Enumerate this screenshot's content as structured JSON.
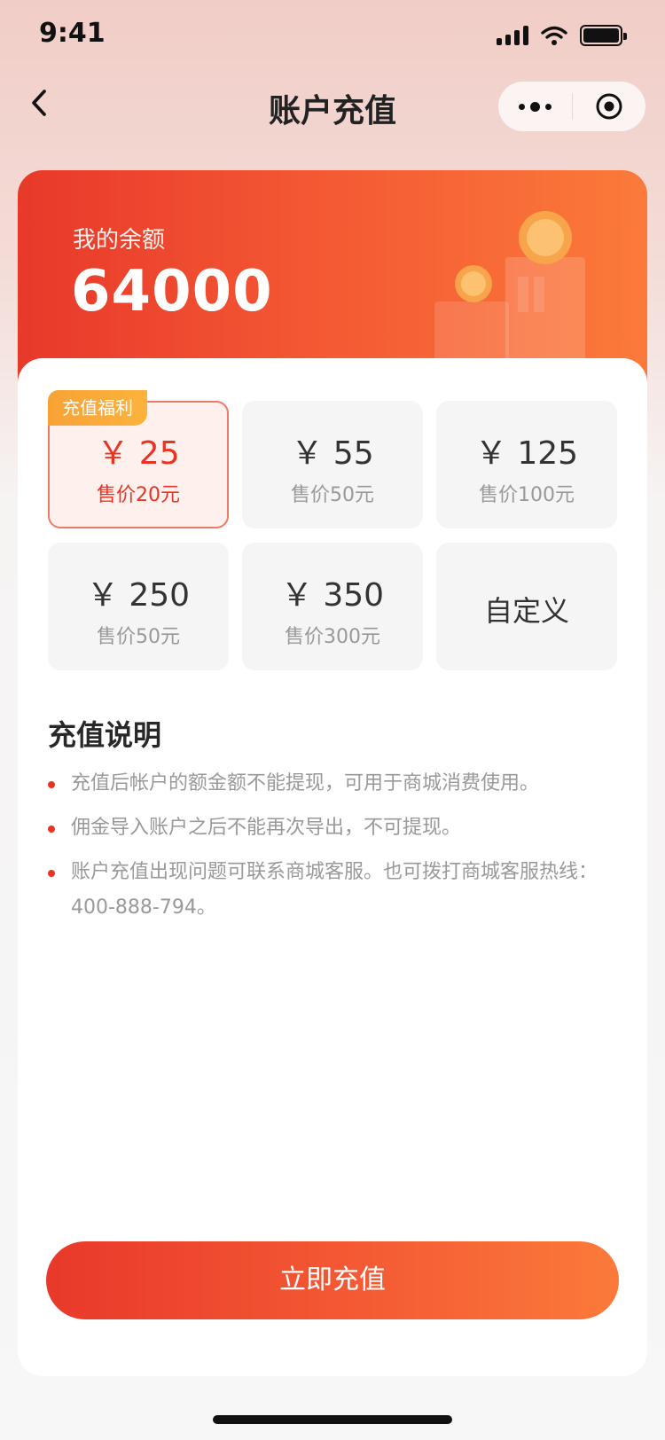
{
  "status_bar": {
    "time": "9:41"
  },
  "nav": {
    "title": "账户充值"
  },
  "balance": {
    "label": "我的余额",
    "value": "64000"
  },
  "options": [
    {
      "amount": "￥ 25",
      "price": "售价20元",
      "badge": "充值福利",
      "selected": true
    },
    {
      "amount": "￥ 55",
      "price": "售价50元"
    },
    {
      "amount": "￥ 125",
      "price": "售价100元"
    },
    {
      "amount": "￥ 250",
      "price": "售价50元"
    },
    {
      "amount": "￥ 350",
      "price": "售价300元"
    },
    {
      "custom_label": "自定义"
    }
  ],
  "notes": {
    "title": "充值说明",
    "items": [
      "充值后帐户的额金额不能提现，可用于商城消费使用。",
      "佣金导入账户之后不能再次导出，不可提现。",
      "账户充值出现问题可联系商城客服。也可拨打商城客服热线：400-888-794。"
    ]
  },
  "actions": {
    "recharge_label": "立即充值"
  },
  "colors": {
    "accent": "#e93323",
    "accent_gradient_end": "#fb7a3a",
    "badge": "#f8a236",
    "note_text": "#999999"
  }
}
